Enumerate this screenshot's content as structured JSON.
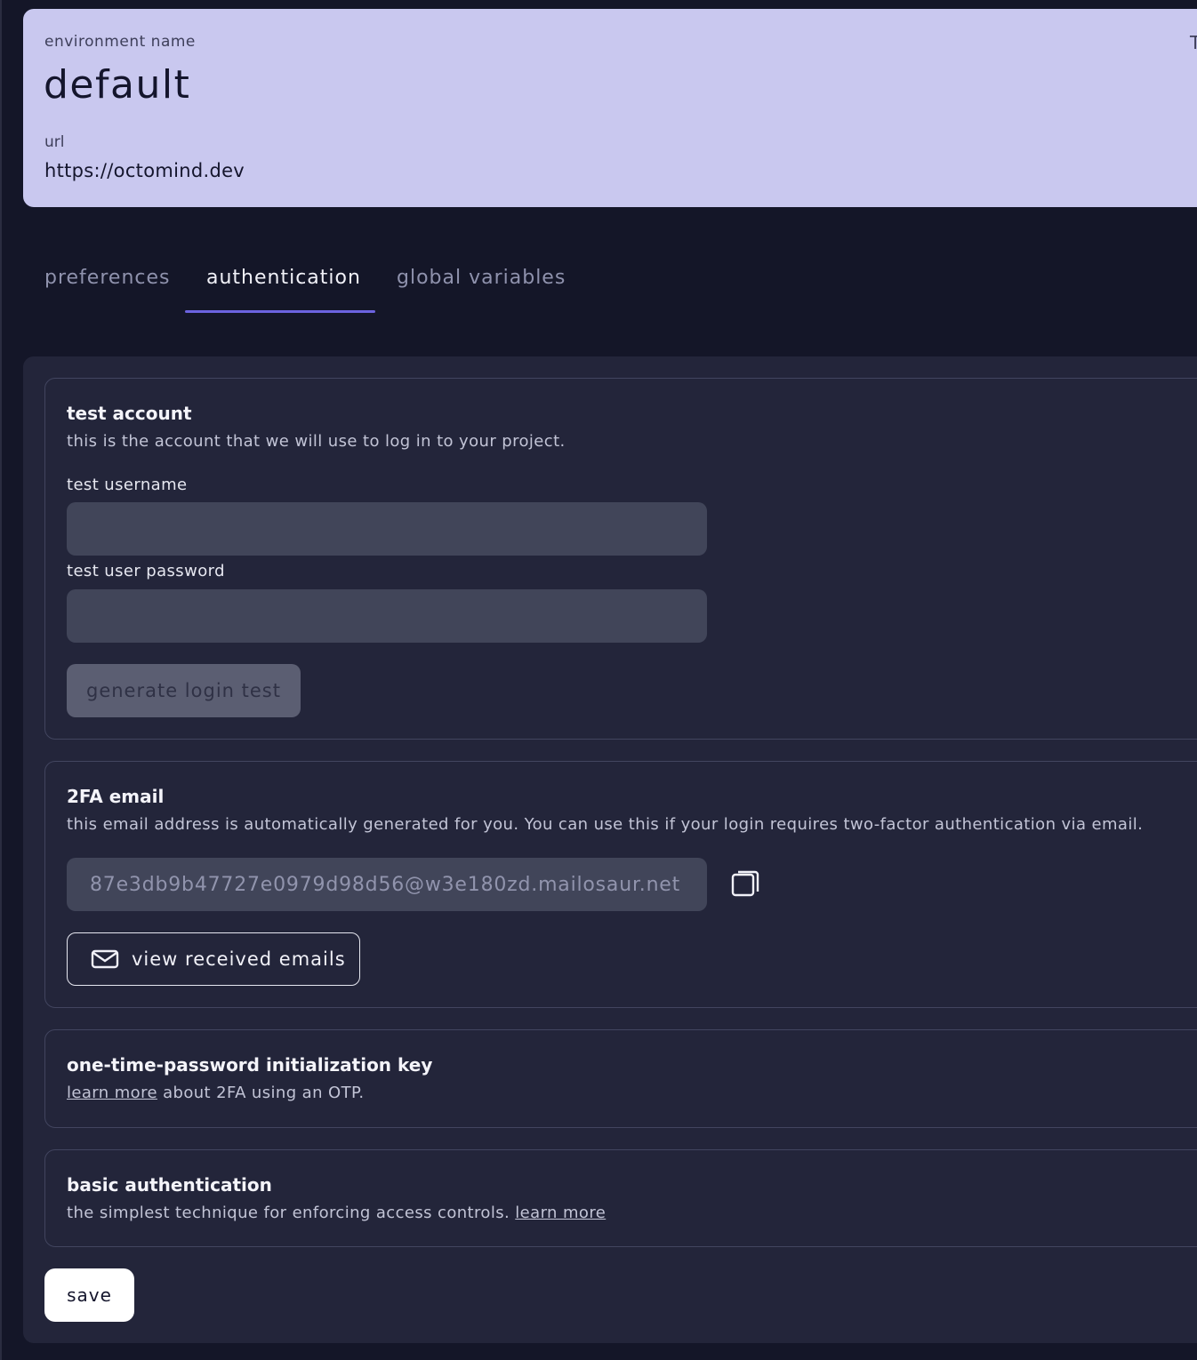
{
  "environment": {
    "name_label": "environment name",
    "name": "default",
    "url_label": "url",
    "url": "https://octomind.dev",
    "corner_text": "T"
  },
  "tabs": [
    {
      "label": "preferences",
      "active": false
    },
    {
      "label": "authentication",
      "active": true
    },
    {
      "label": "global variables",
      "active": false
    }
  ],
  "test_account": {
    "title": "test account",
    "description": "this is the account that we will use to log in to your project.",
    "username_label": "test username",
    "username_value": "",
    "password_label": "test user password",
    "password_value": "",
    "generate_button": "generate login test"
  },
  "twofa_email": {
    "title": "2FA email",
    "description": "this email address is automatically generated for you. You can use this if your login requires two-factor authentication via email.",
    "email": "87e3db9b47727e0979d98d56@w3e180zd.mailosaur.net",
    "view_button": "view received emails",
    "copy_icon": "copy-icon",
    "mail_icon": "envelope-icon"
  },
  "otp": {
    "title": "one-time-password initialization key",
    "link_text": "learn more",
    "description_rest": " about 2FA using an OTP."
  },
  "basic_auth": {
    "title": "basic authentication",
    "description": "the simplest technique for enforcing access controls. ",
    "link_text": "learn more"
  },
  "save_button": "save",
  "colors": {
    "background": "#141628",
    "header_card": "#c9c8ef",
    "panel": "#23253a",
    "accent": "#6c63e0",
    "input": "#414559"
  }
}
